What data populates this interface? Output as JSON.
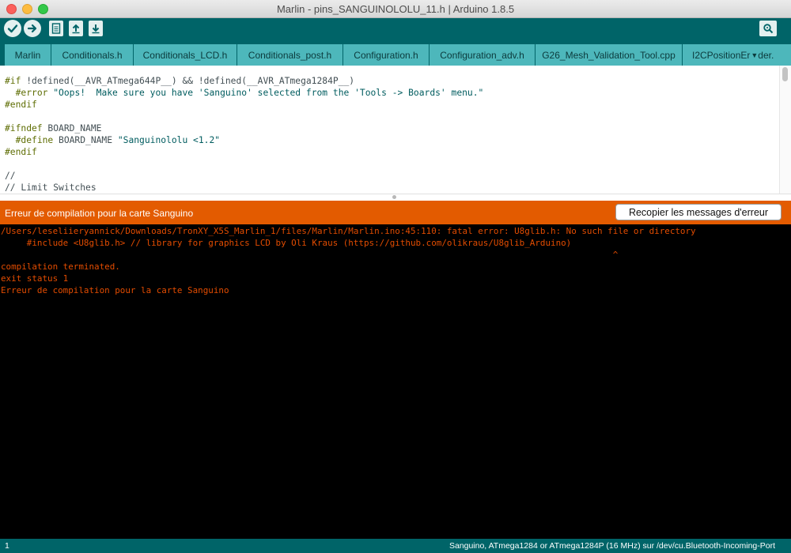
{
  "window": {
    "title": "Marlin - pins_SANGUINOLOLU_11.h | Arduino 1.8.5"
  },
  "toolbar": {
    "buttons": [
      {
        "name": "verify",
        "icon": "check-icon"
      },
      {
        "name": "upload",
        "icon": "arrow-right-icon"
      },
      {
        "name": "new",
        "icon": "new-file-icon"
      },
      {
        "name": "open",
        "icon": "arrow-up-icon"
      },
      {
        "name": "save",
        "icon": "arrow-down-icon"
      },
      {
        "name": "serial-monitor",
        "icon": "magnifier-icon"
      }
    ]
  },
  "tabs": [
    {
      "label": "Marlin"
    },
    {
      "label": "Conditionals.h"
    },
    {
      "label": "Conditionals_LCD.h"
    },
    {
      "label": "Conditionals_post.h"
    },
    {
      "label": "Configuration.h"
    },
    {
      "label": "Configuration_adv.h"
    },
    {
      "label": "G26_Mesh_Validation_Tool.cpp"
    },
    {
      "label": "I2CPositionEr"
    }
  ],
  "tab_menu_label": "der.",
  "editor": {
    "lines": [
      [
        {
          "t": "#if",
          "c": "pp"
        },
        {
          "t": " !defined(__AVR_ATmega644P__) && !defined(__AVR_ATmega1284P__)"
        }
      ],
      [
        {
          "t": "  "
        },
        {
          "t": "#error",
          "c": "pp"
        },
        {
          "t": " "
        },
        {
          "t": "\"Oops!  Make sure you have 'Sanguino' selected from the 'Tools -> Boards' menu.\"",
          "c": "str"
        }
      ],
      [
        {
          "t": "#endif",
          "c": "pp"
        }
      ],
      [
        {
          "t": ""
        }
      ],
      [
        {
          "t": "#ifndef",
          "c": "pp"
        },
        {
          "t": " BOARD_NAME"
        }
      ],
      [
        {
          "t": "  "
        },
        {
          "t": "#define",
          "c": "pp"
        },
        {
          "t": " BOARD_NAME "
        },
        {
          "t": "\"Sanguinololu <1.2\"",
          "c": "str"
        }
      ],
      [
        {
          "t": "#endif",
          "c": "pp"
        }
      ],
      [
        {
          "t": ""
        }
      ],
      [
        {
          "t": "//"
        }
      ],
      [
        {
          "t": "// Limit Switches"
        }
      ]
    ]
  },
  "error_bar": {
    "message": "Erreur de compilation pour la carte Sanguino",
    "copy_button": "Recopier les messages d'erreur"
  },
  "console": {
    "lines": [
      "/Users/leseliieryannick/Downloads/TronXY_X5S_Marlin_1/files/Marlin/Marlin.ino:45:110: fatal error: U8glib.h: No such file or directory",
      "     #include <U8glib.h> // library for graphics LCD by Oli Kraus (https://github.com/olikraus/U8glib_Arduino)",
      "                                                                                                                      ^",
      "compilation terminated.",
      "exit status 1",
      "Erreur de compilation pour la carte Sanguino"
    ]
  },
  "status": {
    "line_number": "1",
    "board_info": "Sanguino, ATmega1284 or ATmega1284P (16 MHz) sur /dev/cu.Bluetooth-Incoming-Port"
  },
  "colors": {
    "teal_dark": "#006468",
    "tab": "#4db7bb",
    "error_orange": "#e35b00",
    "console_text": "#e34c00"
  }
}
